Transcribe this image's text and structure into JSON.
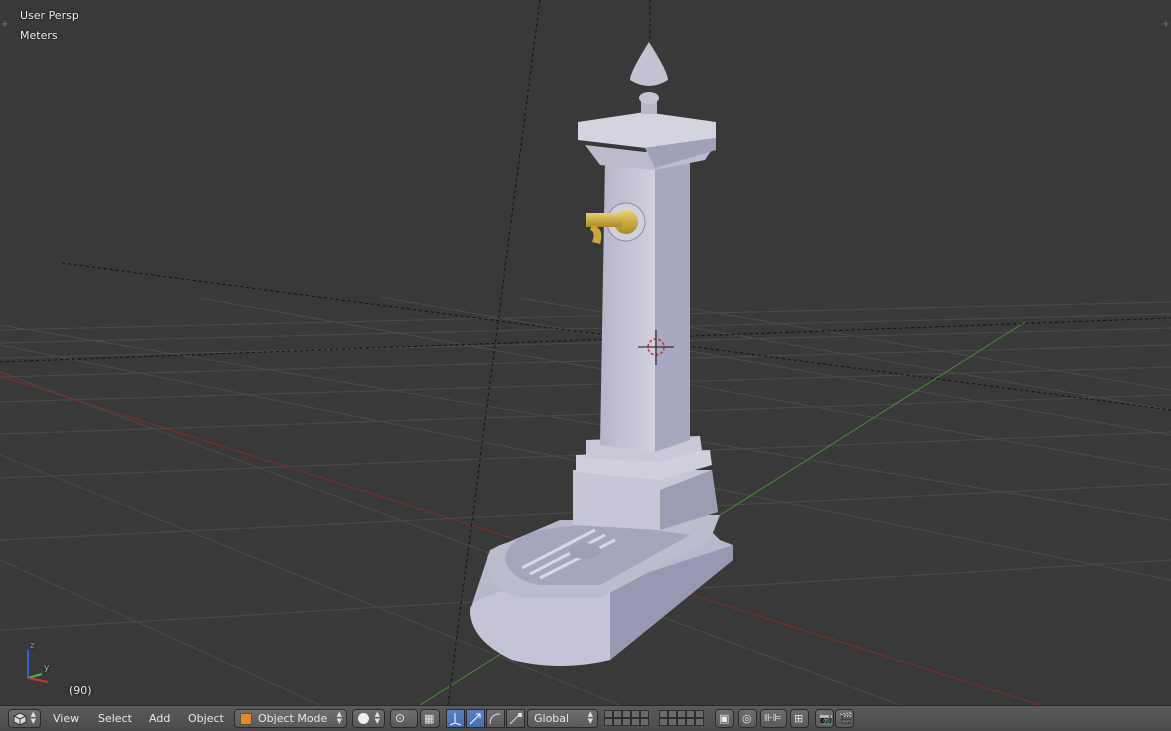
{
  "viewport": {
    "view_name": "User Persp",
    "units": "Meters",
    "frame": "(90)",
    "axis_labels": {
      "z": "z",
      "y": "y"
    },
    "colors": {
      "background": "#393939",
      "grid": "#4a4a4a",
      "x_axis": "#8a2a2a",
      "y_axis": "#4a8a3a",
      "object_light": "#c9c9d8",
      "object_shadow": "#8f8fa8",
      "brass": "#c8a838"
    }
  },
  "header": {
    "editor_type_icon": "cube-editor-icon",
    "menus": [
      "View",
      "Select",
      "Add",
      "Object"
    ],
    "mode": "Object Mode",
    "orientation": "Global",
    "icons": {
      "mode": "object-mode-icon",
      "shading": "sphere-solid-icon",
      "pivot": "pivot-point-icon",
      "manipulator": "manipulator-icon",
      "translate": "translate-icon",
      "rotate": "rotate-icon",
      "scale": "scale-icon",
      "lock": "lock-layers-icon",
      "proportional": "proportional-edit-icon",
      "snap": "snap-icon",
      "snap_target": "snap-target-icon",
      "render": "render-camera-icon",
      "render_anim": "render-animation-icon"
    }
  }
}
